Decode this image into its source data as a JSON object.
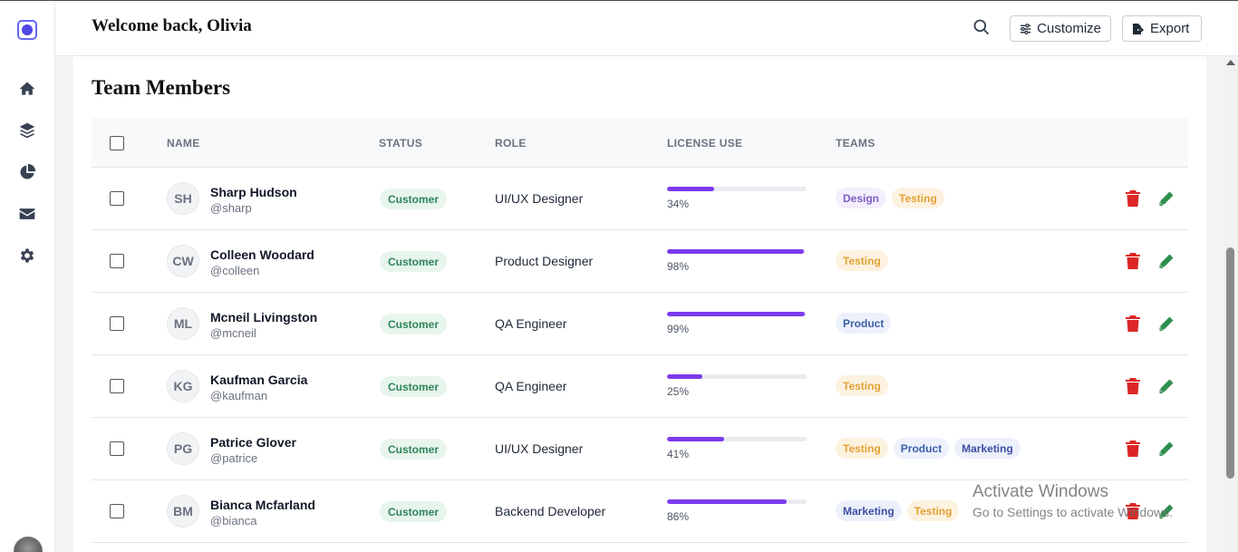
{
  "header": {
    "welcome": "Welcome back, Olivia",
    "customize_label": "Customize",
    "export_label": "Export"
  },
  "sidebar": {
    "items": [
      {
        "icon": "home-icon"
      },
      {
        "icon": "layers-icon"
      },
      {
        "icon": "pie-chart-icon"
      },
      {
        "icon": "mail-icon"
      },
      {
        "icon": "gear-icon"
      }
    ]
  },
  "main": {
    "title": "Team Members",
    "columns": {
      "name": "NAME",
      "status": "STATUS",
      "role": "ROLE",
      "license": "LICENSE USE",
      "teams": "TEAMS"
    },
    "rows": [
      {
        "initials": "SH",
        "name": "Sharp Hudson",
        "handle": "@sharp",
        "status": "Customer",
        "role": "UI/UX Designer",
        "license_pct": 34,
        "license_label": "34%",
        "teams": [
          "Design",
          "Testing"
        ]
      },
      {
        "initials": "CW",
        "name": "Colleen Woodard",
        "handle": "@colleen",
        "status": "Customer",
        "role": "Product Designer",
        "license_pct": 98,
        "license_label": "98%",
        "teams": [
          "Testing"
        ]
      },
      {
        "initials": "ML",
        "name": "Mcneil Livingston",
        "handle": "@mcneil",
        "status": "Customer",
        "role": "QA Engineer",
        "license_pct": 99,
        "license_label": "99%",
        "teams": [
          "Product"
        ]
      },
      {
        "initials": "KG",
        "name": "Kaufman Garcia",
        "handle": "@kaufman",
        "status": "Customer",
        "role": "QA Engineer",
        "license_pct": 25,
        "license_label": "25%",
        "teams": [
          "Testing"
        ]
      },
      {
        "initials": "PG",
        "name": "Patrice Glover",
        "handle": "@patrice",
        "status": "Customer",
        "role": "UI/UX Designer",
        "license_pct": 41,
        "license_label": "41%",
        "teams": [
          "Testing",
          "Product",
          "Marketing"
        ]
      },
      {
        "initials": "BM",
        "name": "Bianca Mcfarland",
        "handle": "@bianca",
        "status": "Customer",
        "role": "Backend Developer",
        "license_pct": 86,
        "license_label": "86%",
        "teams": [
          "Marketing",
          "Testing"
        ]
      }
    ]
  },
  "watermark": {
    "line1": "Activate Windows",
    "line2": "Go to Settings to activate Windows."
  },
  "colors": {
    "accent": "#7c3aed",
    "delete": "#dc2626",
    "edit": "#2f8f4e",
    "status_bg": "#e8f5ec",
    "status_text": "#2f855a"
  }
}
